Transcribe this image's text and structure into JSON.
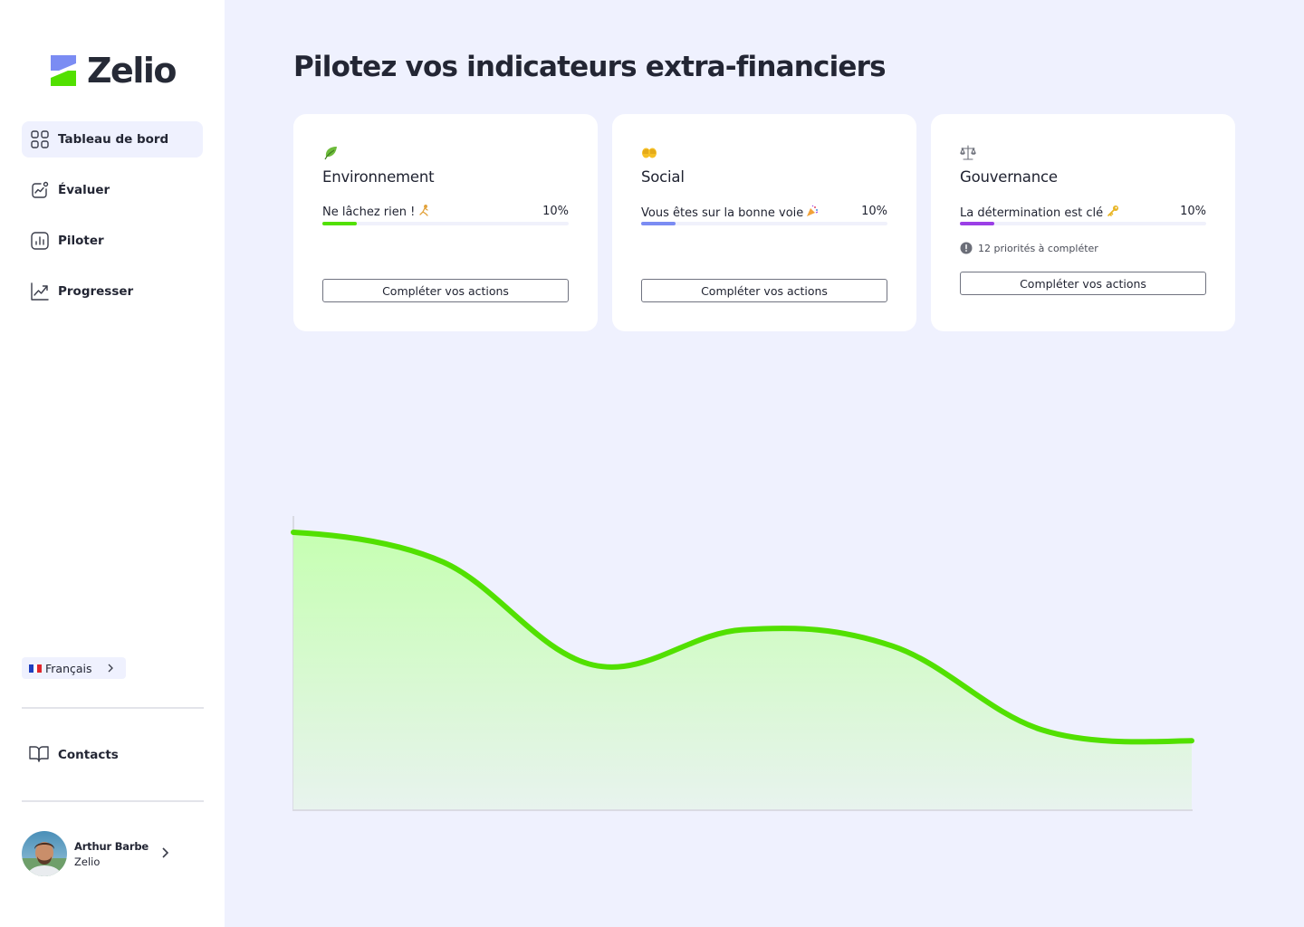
{
  "brand": {
    "name": "Zelio",
    "colors": {
      "green": "#52e000",
      "blue": "#7b8cf3",
      "purple": "#9b3fe6"
    }
  },
  "sidebar": {
    "nav": [
      {
        "label": "Tableau de bord",
        "icon": "grid-icon",
        "active": true
      },
      {
        "label": "Évaluer",
        "icon": "chart-line-icon",
        "active": false
      },
      {
        "label": "Piloter",
        "icon": "bar-chart-icon",
        "active": false
      },
      {
        "label": "Progresser",
        "icon": "trend-up-icon",
        "active": false
      }
    ],
    "language": {
      "label": "Français",
      "icon": "flag-fr-icon"
    },
    "contacts": {
      "label": "Contacts",
      "icon": "book-icon"
    },
    "user": {
      "name": "Arthur Barbe",
      "org": "Zelio"
    }
  },
  "main": {
    "title": "Pilotez vos indicateurs extra-financiers",
    "cards": [
      {
        "name": "Environnement",
        "icon": "leaf-icon",
        "message": "Ne lâchez rien !",
        "message_emoji": "runner-icon",
        "progress_percent": 10,
        "progress_label": "10%",
        "bar_color": "#52e000",
        "action": "Compléter vos actions"
      },
      {
        "name": "Social",
        "icon": "hands-icon",
        "message": "Vous êtes sur la bonne voie",
        "message_emoji": "party-icon",
        "progress_percent": 10,
        "progress_label": "10%",
        "bar_color": "#7b8cf3",
        "action": "Compléter vos actions"
      },
      {
        "name": "Gouvernance",
        "icon": "scales-icon",
        "message": "La détermination est clé",
        "message_emoji": "key-icon",
        "progress_percent": 10,
        "progress_label": "10%",
        "bar_color": "#9b3fe6",
        "notice": "12 priorités à compléter",
        "action": "Compléter vos actions"
      }
    ]
  },
  "chart_data": {
    "type": "area",
    "title": "",
    "xlabel": "",
    "ylabel": "",
    "grid": false,
    "line_color": "#52e000",
    "x": [
      0,
      1,
      2,
      3,
      4,
      5,
      6
    ],
    "values": [
      100,
      89,
      51,
      64,
      58,
      27,
      23
    ],
    "ylim": [
      0,
      100
    ]
  }
}
